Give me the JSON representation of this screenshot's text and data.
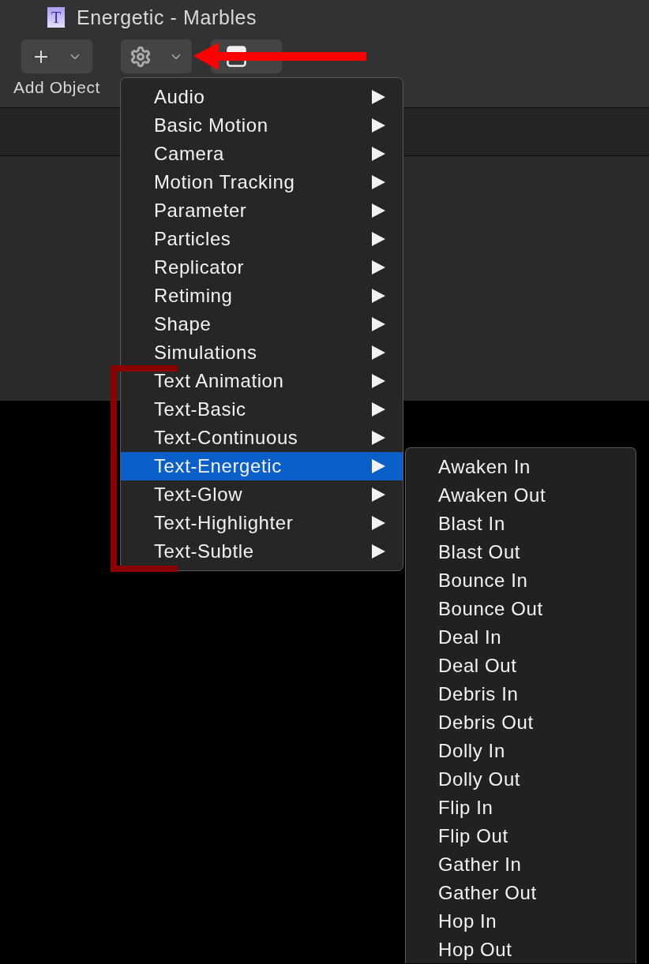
{
  "window": {
    "icon_letter": "T",
    "title": "Energetic - Marbles"
  },
  "toolbar": [
    {
      "kind": "add",
      "label": "Add Object"
    },
    {
      "kind": "gear"
    },
    {
      "kind": "panel"
    }
  ],
  "menu": {
    "items": [
      {
        "label": "Audio",
        "selected": false
      },
      {
        "label": "Basic Motion",
        "selected": false
      },
      {
        "label": "Camera",
        "selected": false
      },
      {
        "label": "Motion Tracking",
        "selected": false
      },
      {
        "label": "Parameter",
        "selected": false
      },
      {
        "label": "Particles",
        "selected": false
      },
      {
        "label": "Replicator",
        "selected": false
      },
      {
        "label": "Retiming",
        "selected": false
      },
      {
        "label": "Shape",
        "selected": false
      },
      {
        "label": "Simulations",
        "selected": false
      },
      {
        "label": "Text Animation",
        "selected": false
      },
      {
        "label": "Text-Basic",
        "selected": false
      },
      {
        "label": "Text-Continuous",
        "selected": false
      },
      {
        "label": "Text-Energetic",
        "selected": true
      },
      {
        "label": "Text-Glow",
        "selected": false
      },
      {
        "label": "Text-Highlighter",
        "selected": false
      },
      {
        "label": "Text-Subtle",
        "selected": false
      }
    ]
  },
  "submenu": {
    "items": [
      {
        "label": "Awaken In",
        "selected": false
      },
      {
        "label": "Awaken Out",
        "selected": false
      },
      {
        "label": "Blast In",
        "selected": false
      },
      {
        "label": "Blast Out",
        "selected": false
      },
      {
        "label": "Bounce In",
        "selected": false
      },
      {
        "label": "Bounce Out",
        "selected": false
      },
      {
        "label": "Deal In",
        "selected": false
      },
      {
        "label": "Deal Out",
        "selected": false
      },
      {
        "label": "Debris In",
        "selected": false
      },
      {
        "label": "Debris Out",
        "selected": false
      },
      {
        "label": "Dolly In",
        "selected": false
      },
      {
        "label": "Dolly Out",
        "selected": false
      },
      {
        "label": "Flip In",
        "selected": false
      },
      {
        "label": "Flip Out",
        "selected": false
      },
      {
        "label": "Gather In",
        "selected": false
      },
      {
        "label": "Gather Out",
        "selected": false
      },
      {
        "label": "Hop In",
        "selected": false
      },
      {
        "label": "Hop Out",
        "selected": false
      }
    ]
  }
}
